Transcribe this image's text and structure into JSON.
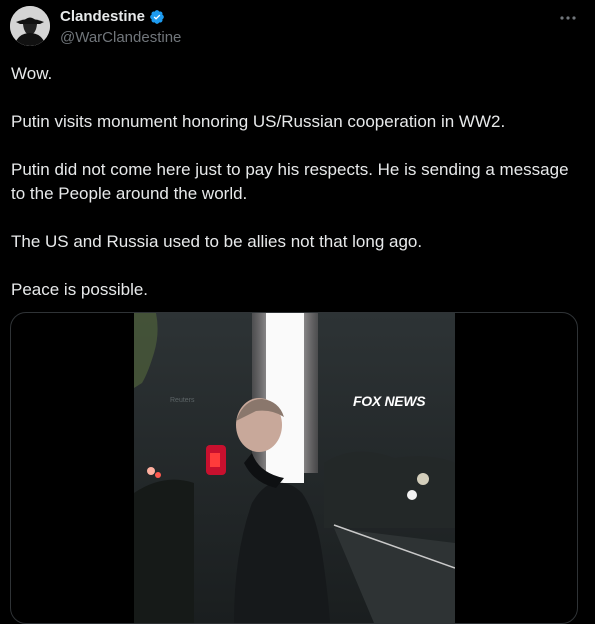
{
  "author": {
    "name": "Clandestine",
    "handle": "@WarClandestine"
  },
  "icons": {
    "avatar": "spy-silhouette-avatar",
    "verified": "verified-badge-icon",
    "more": "more-options-icon",
    "verified_color": "#1d9bf0"
  },
  "tweet": {
    "paragraphs": [
      "Wow.",
      "Putin visits monument honoring US/Russian cooperation in WW2.",
      "Putin did not come here just to pay his respects. He is sending a message to the People around the world.",
      "The US and Russia used to be allies not that long ago.",
      "Peace is possible."
    ]
  },
  "media": {
    "watermark": "FOX NEWS",
    "source_label": "Reuters"
  }
}
